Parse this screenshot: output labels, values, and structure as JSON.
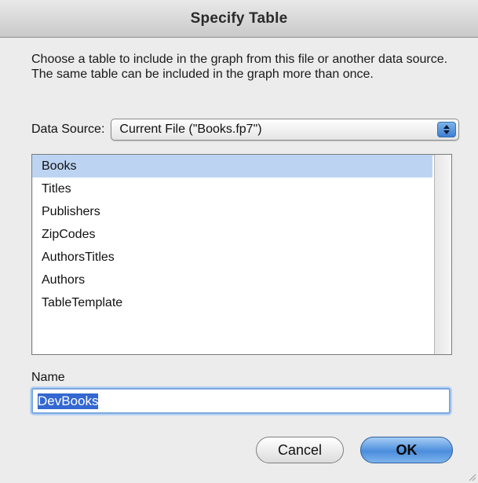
{
  "dialog": {
    "title": "Specify Table",
    "instructions": "Choose a table to include in the graph from this file or another data source.  The same table can be included in the graph more than once.",
    "data_source": {
      "label": "Data Source:",
      "selected": "Current File (\"Books.fp7\")"
    },
    "tables": [
      {
        "label": "Books",
        "selected": true
      },
      {
        "label": "Titles",
        "selected": false
      },
      {
        "label": "Publishers",
        "selected": false
      },
      {
        "label": "ZipCodes",
        "selected": false
      },
      {
        "label": "AuthorsTitles",
        "selected": false
      },
      {
        "label": "Authors",
        "selected": false
      },
      {
        "label": "TableTemplate",
        "selected": false
      }
    ],
    "name": {
      "label": "Name",
      "value": "DevBooks"
    },
    "buttons": {
      "cancel": "Cancel",
      "ok": "OK"
    }
  },
  "colors": {
    "selection": "#bcd4f2",
    "accent": "#4b8ddc"
  },
  "icons": {
    "popup_arrows": "up-down-arrows-icon",
    "resize": "resize-grip-icon"
  }
}
